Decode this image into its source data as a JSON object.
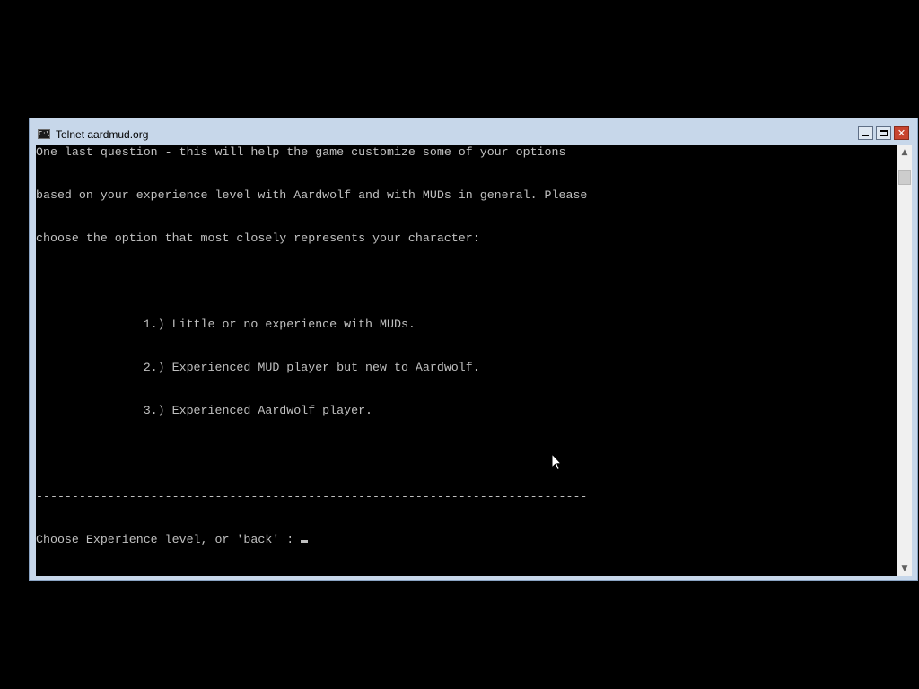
{
  "window": {
    "title": "Telnet aardmud.org",
    "app_icon_label": "C:\\",
    "buttons": {
      "minimize_icon": "minimize-icon",
      "maximize_icon": "maximize-icon",
      "close_icon": "close-icon",
      "close_glyph": "✕"
    }
  },
  "console": {
    "lines": [
      "-----------------------------------------------------------------------------",
      "One last question - this will help the game customize some of your options",
      "based on your experience level with Aardwolf and with MUDs in general. Please",
      "choose the option that most closely represents your character:",
      "",
      "               1.) Little or no experience with MUDs.",
      "               2.) Experienced MUD player but new to Aardwolf.",
      "               3.) Experienced Aardwolf player.",
      "",
      "-----------------------------------------------------------------------------"
    ],
    "prompt": "Choose Experience level, or 'back' : "
  },
  "scrollbar": {
    "up_glyph": "▲",
    "down_glyph": "▼"
  },
  "colors": {
    "desktop": "#000000",
    "window_frame": "#c7d7ea",
    "console_bg": "#000000",
    "console_fg": "#c0c0c0",
    "close_button": "#c8442f"
  }
}
